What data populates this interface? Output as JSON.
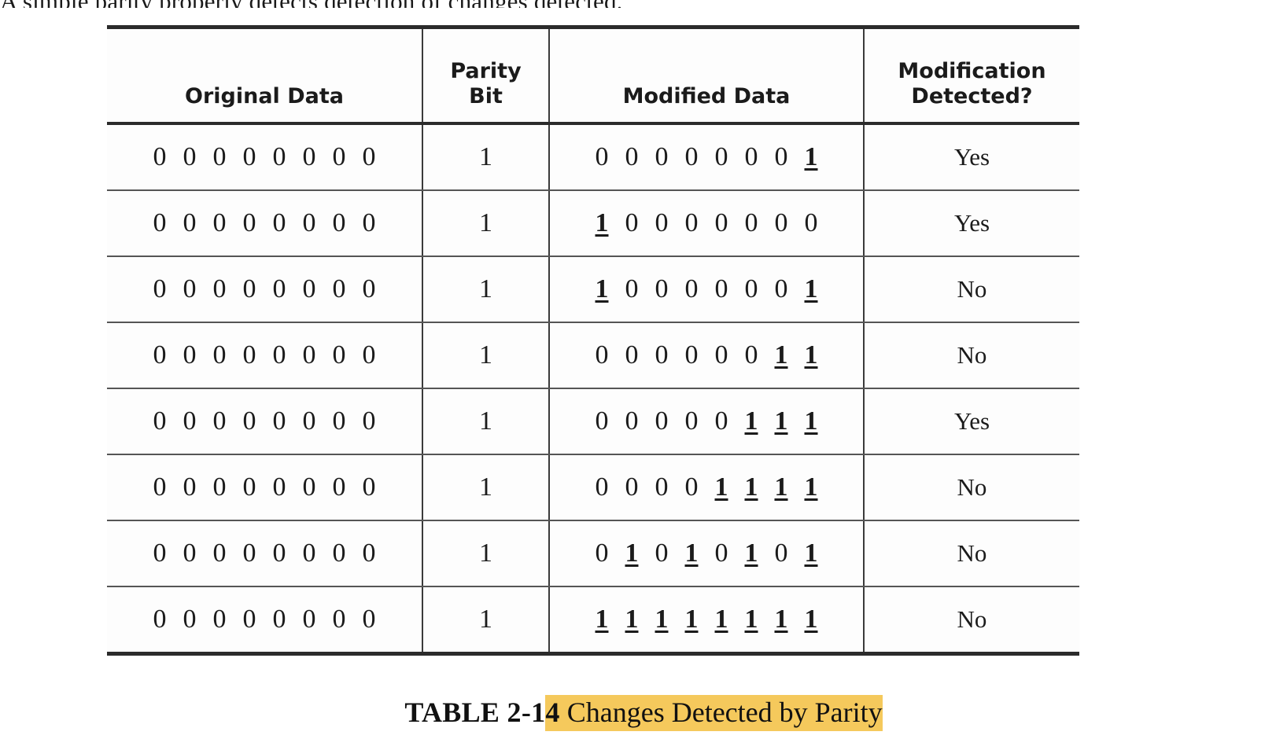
{
  "page": {
    "clipped_top_line": "A simple parity properly detects detection of changes detected."
  },
  "table": {
    "headers": [
      "Original Data",
      "Parity Bit",
      "Modified Data",
      "Modification Detected?"
    ],
    "header_lines": {
      "original": "Original Data",
      "parity_line1": "Parity",
      "parity_line2": "Bit",
      "modified": "Modified Data",
      "detected_line1": "Modification",
      "detected_line2": "Detected?"
    },
    "rows": [
      {
        "original": "0 0 0 0 0 0 0 0",
        "parity": "1",
        "modified": "0 0 0 0 0 0 0 1",
        "modified_bits": [
          "0",
          "0",
          "0",
          "0",
          "0",
          "0",
          "0",
          "1"
        ],
        "flipped_indices": [
          7
        ],
        "detected": "Yes"
      },
      {
        "original": "0 0 0 0 0 0 0 0",
        "parity": "1",
        "modified": "1 0 0 0 0 0 0 0",
        "modified_bits": [
          "1",
          "0",
          "0",
          "0",
          "0",
          "0",
          "0",
          "0"
        ],
        "flipped_indices": [
          0
        ],
        "detected": "Yes"
      },
      {
        "original": "0 0 0 0 0 0 0 0",
        "parity": "1",
        "modified": "1 0 0 0 0 0 0 1",
        "modified_bits": [
          "1",
          "0",
          "0",
          "0",
          "0",
          "0",
          "0",
          "1"
        ],
        "flipped_indices": [
          0,
          7
        ],
        "detected": "No"
      },
      {
        "original": "0 0 0 0 0 0 0 0",
        "parity": "1",
        "modified": "0 0 0 0 0 0 1 1",
        "modified_bits": [
          "0",
          "0",
          "0",
          "0",
          "0",
          "0",
          "1",
          "1"
        ],
        "flipped_indices": [
          6,
          7
        ],
        "detected": "No"
      },
      {
        "original": "0 0 0 0 0 0 0 0",
        "parity": "1",
        "modified": "0 0 0 0 0 1 1 1",
        "modified_bits": [
          "0",
          "0",
          "0",
          "0",
          "0",
          "1",
          "1",
          "1"
        ],
        "flipped_indices": [
          5,
          6,
          7
        ],
        "detected": "Yes"
      },
      {
        "original": "0 0 0 0 0 0 0 0",
        "parity": "1",
        "modified": "0 0 0 0 1 1 1 1",
        "modified_bits": [
          "0",
          "0",
          "0",
          "0",
          "1",
          "1",
          "1",
          "1"
        ],
        "flipped_indices": [
          4,
          5,
          6,
          7
        ],
        "detected": "No"
      },
      {
        "original": "0 0 0 0 0 0 0 0",
        "parity": "1",
        "modified": "0 1 0 1 0 1 0 1",
        "modified_bits": [
          "0",
          "1",
          "0",
          "1",
          "0",
          "1",
          "0",
          "1"
        ],
        "flipped_indices": [
          1,
          3,
          5,
          7
        ],
        "detected": "No"
      },
      {
        "original": "0 0 0 0 0 0 0 0",
        "parity": "1",
        "modified": "1 1 1 1 1 1 1 1",
        "modified_bits": [
          "1",
          "1",
          "1",
          "1",
          "1",
          "1",
          "1",
          "1"
        ],
        "flipped_indices": [
          0,
          1,
          2,
          3,
          4,
          5,
          6,
          7
        ],
        "detected": "No"
      }
    ],
    "original_bits": [
      "0",
      "0",
      "0",
      "0",
      "0",
      "0",
      "0",
      "0"
    ]
  },
  "caption": {
    "label": "TABLE 2-1",
    "label_highlighted": "4",
    "text": " Changes Detected by Parity"
  },
  "colors": {
    "highlight": "#F5C95C",
    "rule": "#2b2b2b",
    "text": "#1b1b1b"
  }
}
